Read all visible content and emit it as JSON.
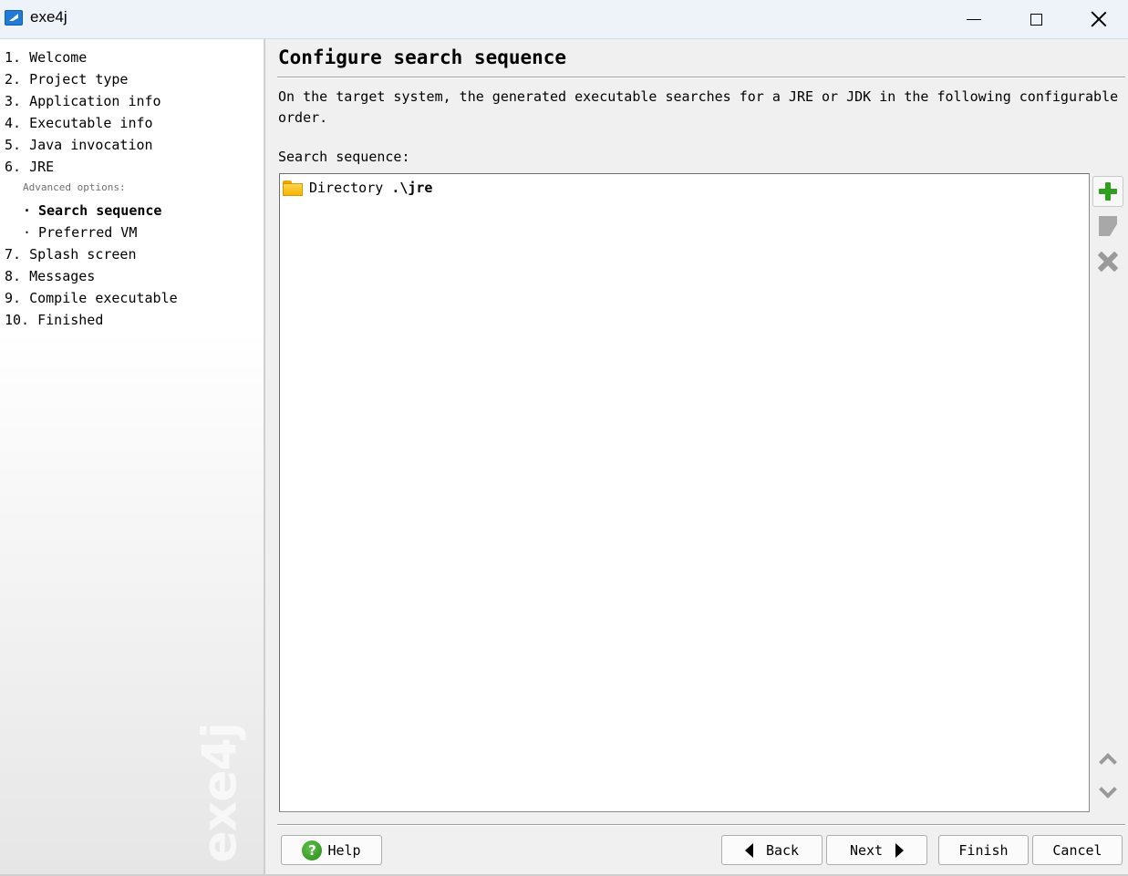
{
  "window": {
    "title": "exe4j",
    "icons": {
      "app": "exe4j-app-icon",
      "minimize": "minimize-icon",
      "maximize": "maximize-icon",
      "close": "close-icon"
    }
  },
  "sidebar": {
    "steps": [
      {
        "label": "1. Welcome"
      },
      {
        "label": "2. Project type"
      },
      {
        "label": "3. Application info"
      },
      {
        "label": "4. Executable info"
      },
      {
        "label": "5. Java invocation"
      },
      {
        "label": "6. JRE"
      }
    ],
    "advanced_label": "Advanced options:",
    "sub_items": [
      {
        "bullet": "·",
        "label": "Search sequence",
        "active": true
      },
      {
        "bullet": "·",
        "label": "Preferred VM",
        "active": false
      }
    ],
    "steps_after": [
      {
        "label": "7. Splash screen"
      },
      {
        "label": "8. Messages"
      },
      {
        "label": "9. Compile executable"
      },
      {
        "label": "10. Finished"
      }
    ],
    "watermark": "exe4j"
  },
  "main": {
    "title": "Configure search sequence",
    "description": "On the target system, the generated executable searches for a JRE or JDK in the following configurable order.",
    "list_label": "Search sequence:",
    "entries": [
      {
        "icon": "folder-icon",
        "type_label": "Directory ",
        "path": ".\\jre"
      }
    ],
    "side_buttons": [
      "add-icon",
      "edit-icon",
      "delete-icon",
      "move-up-icon",
      "move-down-icon"
    ]
  },
  "footer": {
    "help_label": "Help",
    "back_label": "Back",
    "next_label": "Next",
    "finish_label": "Finish",
    "cancel_label": "Cancel"
  },
  "colors": {
    "titlebar_bg": "#eef3f9",
    "add_green": "#2ea01e",
    "help_green": "#3aa02a",
    "folder_yellow": "#ffc61a"
  }
}
